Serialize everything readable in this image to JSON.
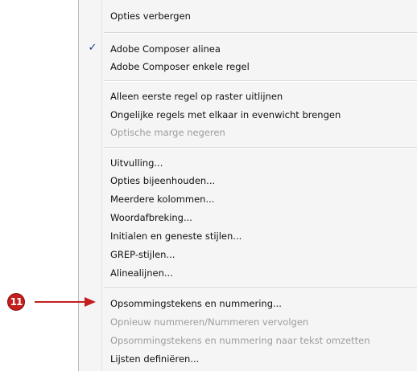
{
  "menu": {
    "items": [
      {
        "label": "Opties verbergen",
        "checked": false,
        "disabled": false
      },
      {
        "label": "Adobe Composer alinea",
        "checked": true,
        "disabled": false
      },
      {
        "label": "Adobe Composer enkele regel",
        "checked": false,
        "disabled": false
      },
      {
        "label": "Alleen eerste regel op raster uitlijnen",
        "checked": false,
        "disabled": false
      },
      {
        "label": "Ongelijke regels met elkaar in evenwicht brengen",
        "checked": false,
        "disabled": false
      },
      {
        "label": "Optische marge negeren",
        "checked": false,
        "disabled": true
      },
      {
        "label": "Uitvulling...",
        "checked": false,
        "disabled": false
      },
      {
        "label": "Opties bijeenhouden...",
        "checked": false,
        "disabled": false
      },
      {
        "label": "Meerdere kolommen...",
        "checked": false,
        "disabled": false
      },
      {
        "label": "Woordafbreking...",
        "checked": false,
        "disabled": false
      },
      {
        "label": "Initialen en geneste stijlen...",
        "checked": false,
        "disabled": false
      },
      {
        "label": "GREP-stijlen...",
        "checked": false,
        "disabled": false
      },
      {
        "label": "Alinealijnen...",
        "checked": false,
        "disabled": false
      },
      {
        "label": "Opsommingstekens en nummering...",
        "checked": false,
        "disabled": false
      },
      {
        "label": "Opnieuw nummeren/Nummeren vervolgen",
        "checked": false,
        "disabled": true
      },
      {
        "label": "Opsommingstekens en nummering naar tekst omzetten",
        "checked": false,
        "disabled": true
      },
      {
        "label": "Lijsten definiëren...",
        "checked": false,
        "disabled": false
      }
    ],
    "checkmark_glyph": "✓"
  },
  "callout": {
    "number": "11",
    "color": "#c41e1e",
    "arrow_icon": "right-arrow-icon"
  }
}
